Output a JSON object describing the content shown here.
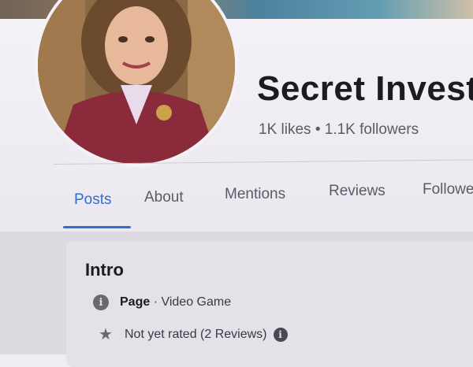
{
  "page": {
    "name": "Secret Invest",
    "likes": "1K likes",
    "separator": "•",
    "followers": "1.1K followers"
  },
  "tabs": [
    {
      "label": "Posts",
      "active": true
    },
    {
      "label": "About",
      "active": false
    },
    {
      "label": "Mentions",
      "active": false
    },
    {
      "label": "Reviews",
      "active": false
    },
    {
      "label": "Followe",
      "active": false
    }
  ],
  "intro": {
    "title": "Intro",
    "category_label": "Page",
    "category_separator": " · ",
    "category_value": "Video Game",
    "rating_text": "Not yet rated (2 Reviews)"
  },
  "icons": {
    "info": "info-icon",
    "star": "star-icon"
  },
  "colors": {
    "accent": "#2b6fd6",
    "text": "#1c1b20",
    "muted": "#5e5a66"
  }
}
